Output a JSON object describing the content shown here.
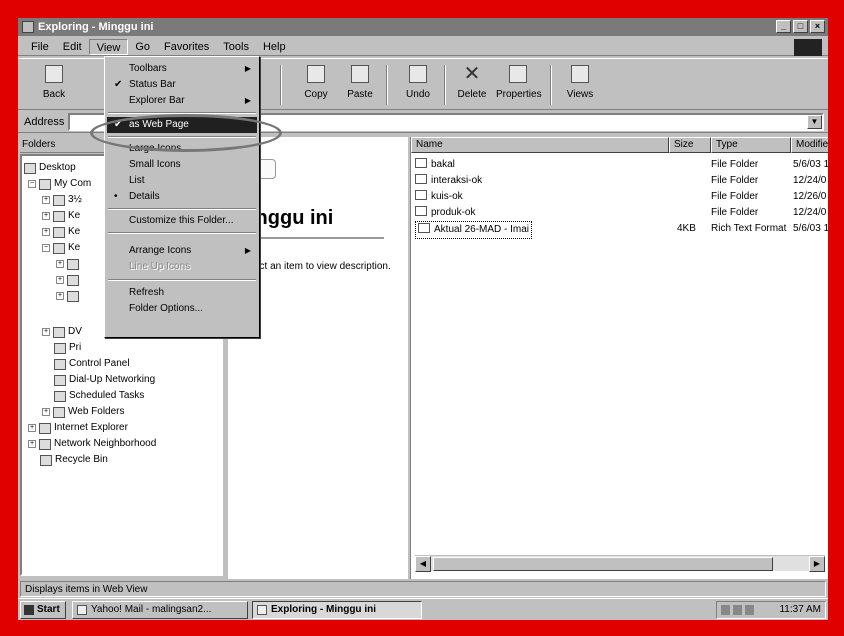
{
  "window": {
    "title": "Exploring - Minggu ini"
  },
  "menubar": {
    "items": [
      "File",
      "Edit",
      "View",
      "Go",
      "Favorites",
      "Tools",
      "Help"
    ]
  },
  "toolbar": {
    "back": "Back",
    "copy": "Copy",
    "paste": "Paste",
    "undo": "Undo",
    "delete": "Delete",
    "properties": "Properties",
    "views": "Views"
  },
  "address": {
    "label": "Address"
  },
  "folders": {
    "header": "Folders",
    "tree": [
      {
        "label": "Desktop"
      },
      {
        "label": "My Com"
      },
      {
        "label": "3½"
      },
      {
        "label": "Ke"
      },
      {
        "label": "Ke"
      },
      {
        "label": "Ke"
      },
      {
        "label": ""
      },
      {
        "label": ""
      },
      {
        "label": ""
      },
      {
        "label": "DV"
      },
      {
        "label": "Pri"
      },
      {
        "label": "Control Panel"
      },
      {
        "label": "Dial-Up Networking"
      },
      {
        "label": "Scheduled Tasks"
      },
      {
        "label": "Web Folders"
      },
      {
        "label": "Internet Explorer"
      },
      {
        "label": "Network Neighborhood"
      },
      {
        "label": "Recycle Bin"
      }
    ]
  },
  "webview": {
    "title": "inggu ini",
    "description": "ect an item to view description."
  },
  "list": {
    "columns": [
      "Name",
      "Size",
      "Type",
      "Modified"
    ],
    "rows": [
      {
        "name": "bakal",
        "size": "",
        "type": "File Folder",
        "modified": "5/6/03 1"
      },
      {
        "name": "interaksi-ok",
        "size": "",
        "type": "File Folder",
        "modified": "12/24/0"
      },
      {
        "name": "kuis-ok",
        "size": "",
        "type": "File Folder",
        "modified": "12/26/0"
      },
      {
        "name": "produk-ok",
        "size": "",
        "type": "File Folder",
        "modified": "12/24/0"
      },
      {
        "name": "Aktual 26-MAD - Imai",
        "size": "4KB",
        "type": "Rich Text Format",
        "modified": "5/6/03 1"
      }
    ]
  },
  "status": {
    "text": "Displays items in Web View"
  },
  "taskbar": {
    "start": "Start",
    "tasks": [
      "Yahoo! Mail - malingsan2...",
      "Exploring - Minggu ini"
    ],
    "clock": "11:37 AM"
  },
  "view_menu": {
    "items": [
      {
        "label": "Toolbars",
        "mark": "",
        "submenu": true
      },
      {
        "label": "Status Bar",
        "mark": "✔",
        "submenu": false
      },
      {
        "label": "Explorer Bar",
        "mark": "",
        "submenu": true
      },
      {
        "label": "as Web Page",
        "mark": "✔",
        "submenu": false,
        "selected": true
      },
      {
        "label": "Large Icons",
        "mark": "",
        "submenu": false
      },
      {
        "label": "Small Icons",
        "mark": "",
        "submenu": false
      },
      {
        "label": "List",
        "mark": "",
        "submenu": false
      },
      {
        "label": "Details",
        "mark": "•",
        "submenu": false
      },
      {
        "label": "Customize this Folder...",
        "mark": "",
        "submenu": false
      },
      {
        "label": "Arrange Icons",
        "mark": "",
        "submenu": true
      },
      {
        "label": "Line Up Icons",
        "mark": "",
        "submenu": false,
        "disabled": true
      },
      {
        "label": "Refresh",
        "mark": "",
        "submenu": false
      },
      {
        "label": "Folder Options...",
        "mark": "",
        "submenu": false
      }
    ]
  }
}
